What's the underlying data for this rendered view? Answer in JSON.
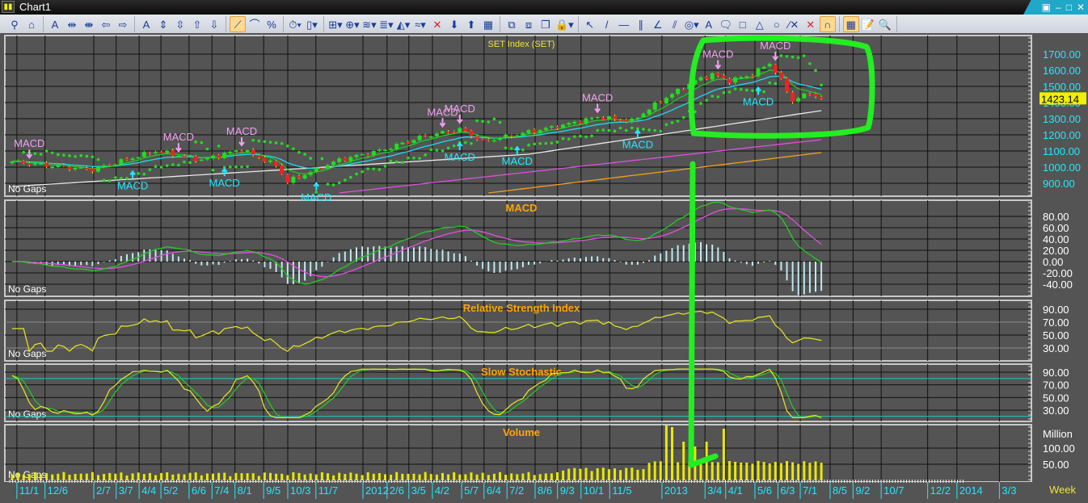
{
  "window": {
    "title": "Chart1",
    "controls": [
      "▣",
      "–",
      "□",
      "✕"
    ]
  },
  "toolbar": {
    "groups": [
      [
        {
          "icon": "pin-icon",
          "glyph": "⚲"
        },
        {
          "icon": "home-icon",
          "glyph": "⌂"
        }
      ],
      [
        {
          "icon": "font-scale-icon",
          "glyph": "A"
        },
        {
          "icon": "expand-horizontal-icon",
          "glyph": "⇹"
        },
        {
          "icon": "compress-horizontal-icon",
          "glyph": "⇼"
        },
        {
          "icon": "scroll-left-icon",
          "glyph": "⇦"
        },
        {
          "icon": "scroll-right-icon",
          "glyph": "⇨"
        }
      ],
      [
        {
          "icon": "axis-font-icon",
          "glyph": "A"
        },
        {
          "icon": "expand-vertical-icon",
          "glyph": "⇕"
        },
        {
          "icon": "compress-vertical-icon",
          "glyph": "⇳"
        },
        {
          "icon": "scroll-up-icon",
          "glyph": "⇧"
        },
        {
          "icon": "scroll-down-icon",
          "glyph": "⇩"
        }
      ],
      [
        {
          "icon": "linear-scale-icon",
          "glyph": "⟋",
          "active": true
        },
        {
          "icon": "log-scale-icon",
          "glyph": "⌒"
        },
        {
          "icon": "percent-scale-icon",
          "glyph": "%"
        }
      ],
      [
        {
          "icon": "period-timer-icon",
          "glyph": "⏱▾"
        },
        {
          "icon": "candlestick-icon",
          "glyph": "▯▾"
        }
      ],
      [
        {
          "icon": "add-indicator-icon",
          "glyph": "⊞▾"
        },
        {
          "icon": "add-trading-system-icon",
          "glyph": "⊕▾"
        },
        {
          "icon": "add-overlay-icon",
          "glyph": "≋▾"
        },
        {
          "icon": "add-panel-icon",
          "glyph": "≣▾"
        },
        {
          "icon": "add-chart-icon",
          "glyph": "◭▾"
        },
        {
          "icon": "remove-indicator-icon",
          "glyph": "≈▾"
        },
        {
          "icon": "delete-icon",
          "glyph": "✕",
          "red": true
        },
        {
          "icon": "move-down-icon",
          "glyph": "⬇"
        },
        {
          "icon": "move-up-icon",
          "glyph": "⬆"
        },
        {
          "icon": "remove-panel-icon",
          "glyph": "▦"
        }
      ],
      [
        {
          "icon": "new-window-icon",
          "glyph": "⧉"
        },
        {
          "icon": "close-window-icon",
          "glyph": "⧈"
        },
        {
          "icon": "cascade-icon",
          "glyph": "❐"
        },
        {
          "icon": "lock-icon",
          "glyph": "🔒▾"
        }
      ],
      [
        {
          "icon": "pointer-icon",
          "glyph": "↖"
        },
        {
          "icon": "line-icon",
          "glyph": "/"
        },
        {
          "icon": "horizontal-line-icon",
          "glyph": "—"
        },
        {
          "icon": "parallel-lines-icon",
          "glyph": "∥"
        },
        {
          "icon": "angle-icon",
          "glyph": "∠"
        },
        {
          "icon": "channel-icon",
          "glyph": "⫽"
        },
        {
          "icon": "fibonacci-icon",
          "glyph": "◎▾"
        },
        {
          "icon": "text-icon",
          "glyph": "A"
        },
        {
          "icon": "callout-icon",
          "glyph": "🗨"
        },
        {
          "icon": "rectangle-icon",
          "glyph": "□"
        },
        {
          "icon": "triangle-icon",
          "glyph": "△"
        },
        {
          "icon": "ellipse-icon",
          "glyph": "○"
        },
        {
          "icon": "delete-drawing-icon",
          "glyph": "⁄✕"
        },
        {
          "icon": "delete-all-icon",
          "glyph": "✕",
          "red": true
        },
        {
          "icon": "magnet-icon",
          "glyph": "∩",
          "active": true
        }
      ],
      [
        {
          "icon": "grid-icon",
          "glyph": "▦",
          "active": true
        },
        {
          "icon": "properties-icon",
          "glyph": "📝"
        },
        {
          "icon": "zoom-icon",
          "glyph": "🔍"
        }
      ]
    ]
  },
  "panels": {
    "price": {
      "title": "SET Index (SET)",
      "gaps": "No Gaps",
      "last_price": "1423.14",
      "ticks": [
        "1700.00",
        "1600.00",
        "1500.00",
        "1400.00",
        "1300.00",
        "1200.00",
        "1100.00",
        "1000.00",
        "900.00"
      ]
    },
    "macd": {
      "title": "MACD",
      "gaps": "No Gaps",
      "ticks": [
        "80.00",
        "60.00",
        "40.00",
        "20.00",
        "0.00",
        "-20.00",
        "-40.00"
      ]
    },
    "rsi": {
      "title": "Relative Strength Index",
      "gaps": "No Gaps",
      "ticks": [
        "90.00",
        "70.00",
        "50.00",
        "30.00"
      ]
    },
    "stoch": {
      "title": "Slow Stochastic",
      "gaps": "No Gaps",
      "ticks": [
        "90.00",
        "70.00",
        "50.00",
        "30.00"
      ]
    },
    "volume": {
      "title": "Volume",
      "gaps": "No Gaps",
      "unit": "Million",
      "ticks": [
        "100.00",
        "50.00"
      ]
    }
  },
  "x_axis": {
    "unit": "Week",
    "labels": [
      {
        "t": "11/1",
        "w": 2.8
      },
      {
        "t": "12/6",
        "w": 7.7
      },
      {
        "t": "2/7",
        "w": 16.2
      },
      {
        "t": "3/7",
        "w": 20.1
      },
      {
        "t": "4/4",
        "w": 24.1
      },
      {
        "t": "5/2",
        "w": 27.9
      },
      {
        "t": "6/6",
        "w": 32.8
      },
      {
        "t": "7/4",
        "w": 36.8
      },
      {
        "t": "8/1",
        "w": 40.8
      },
      {
        "t": "9/5",
        "w": 45.8
      },
      {
        "t": "10/3",
        "w": 50
      },
      {
        "t": "11/7",
        "w": 54.9
      },
      {
        "t": "2012",
        "w": 63.1
      },
      {
        "t": "2/6",
        "w": 67.3
      },
      {
        "t": "3/5",
        "w": 71.1
      },
      {
        "t": "4/2",
        "w": 75.2
      },
      {
        "t": "5/7",
        "w": 80.3
      },
      {
        "t": "6/4",
        "w": 84.2
      },
      {
        "t": "7/2",
        "w": 88.2
      },
      {
        "t": "8/6",
        "w": 93.1
      },
      {
        "t": "9/3",
        "w": 97
      },
      {
        "t": "10/1",
        "w": 101.1
      },
      {
        "t": "11/5",
        "w": 106.1
      },
      {
        "t": "2013",
        "w": 115.2
      },
      {
        "t": "3/4",
        "w": 122.7
      },
      {
        "t": "4/1",
        "w": 126.3
      },
      {
        "t": "5/6",
        "w": 131.4
      },
      {
        "t": "6/3",
        "w": 135.4
      },
      {
        "t": "7/1",
        "w": 139.3
      },
      {
        "t": "8/5",
        "w": 144.5
      },
      {
        "t": "9/2",
        "w": 148.5
      },
      {
        "t": "10/7",
        "w": 153.4
      },
      {
        "t": "12/2",
        "w": 161.5
      },
      {
        "t": "2014",
        "w": 166.6
      },
      {
        "t": "3/3",
        "w": 174
      }
    ]
  },
  "chart_data": {
    "type": "candlestick",
    "title": "SET Index (SET)",
    "weeks": 142,
    "close_keypoints": [
      [
        0,
        1035
      ],
      [
        6,
        1010
      ],
      [
        14,
        985
      ],
      [
        25,
        1100
      ],
      [
        33,
        1045
      ],
      [
        40,
        1110
      ],
      [
        46,
        1010
      ],
      [
        48,
        910
      ],
      [
        53,
        985
      ],
      [
        57,
        1045
      ],
      [
        65,
        1110
      ],
      [
        71,
        1185
      ],
      [
        78,
        1235
      ],
      [
        82,
        1160
      ],
      [
        89,
        1210
      ],
      [
        96,
        1260
      ],
      [
        102,
        1310
      ],
      [
        108,
        1285
      ],
      [
        113,
        1410
      ],
      [
        119,
        1535
      ],
      [
        122,
        1575
      ],
      [
        125,
        1535
      ],
      [
        129,
        1575
      ],
      [
        132,
        1645
      ],
      [
        134,
        1535
      ],
      [
        136,
        1410
      ],
      [
        139,
        1460
      ],
      [
        141,
        1423.14
      ]
    ],
    "long_ma_keypoints": {
      "white": [
        [
          0,
          880
        ],
        [
          50,
          990
        ],
        [
          90,
          1080
        ],
        [
          141,
          1350
        ]
      ],
      "magenta": [
        [
          57,
          840
        ],
        [
          141,
          1170
        ]
      ],
      "orange": [
        [
          83,
          840
        ],
        [
          141,
          1090
        ]
      ]
    },
    "price_range": [
      850,
      1780
    ],
    "macd_range": [
      -50,
      95
    ],
    "rsi_range": [
      20,
      100
    ],
    "stoch_range": [
      15,
      100
    ],
    "volume_range_million": [
      0,
      175
    ],
    "volume_spikes": [
      [
        114,
        170
      ],
      [
        115,
        165
      ],
      [
        117,
        120
      ],
      [
        119,
        105
      ],
      [
        121,
        120
      ],
      [
        124,
        160
      ]
    ],
    "signals": {
      "label": "MACD",
      "sell_weeks": [
        3,
        29,
        40,
        75,
        78,
        102,
        123,
        133
      ],
      "buy_weeks": [
        21,
        37,
        53,
        78,
        88,
        109,
        130
      ]
    }
  },
  "colors": {
    "bg": "#545454",
    "up": "#22dd22",
    "down": "#ee2222",
    "sell": "#f0a0f0",
    "buy": "#22e8ff",
    "annotation": "#22ee22",
    "title": "#ffa500"
  }
}
